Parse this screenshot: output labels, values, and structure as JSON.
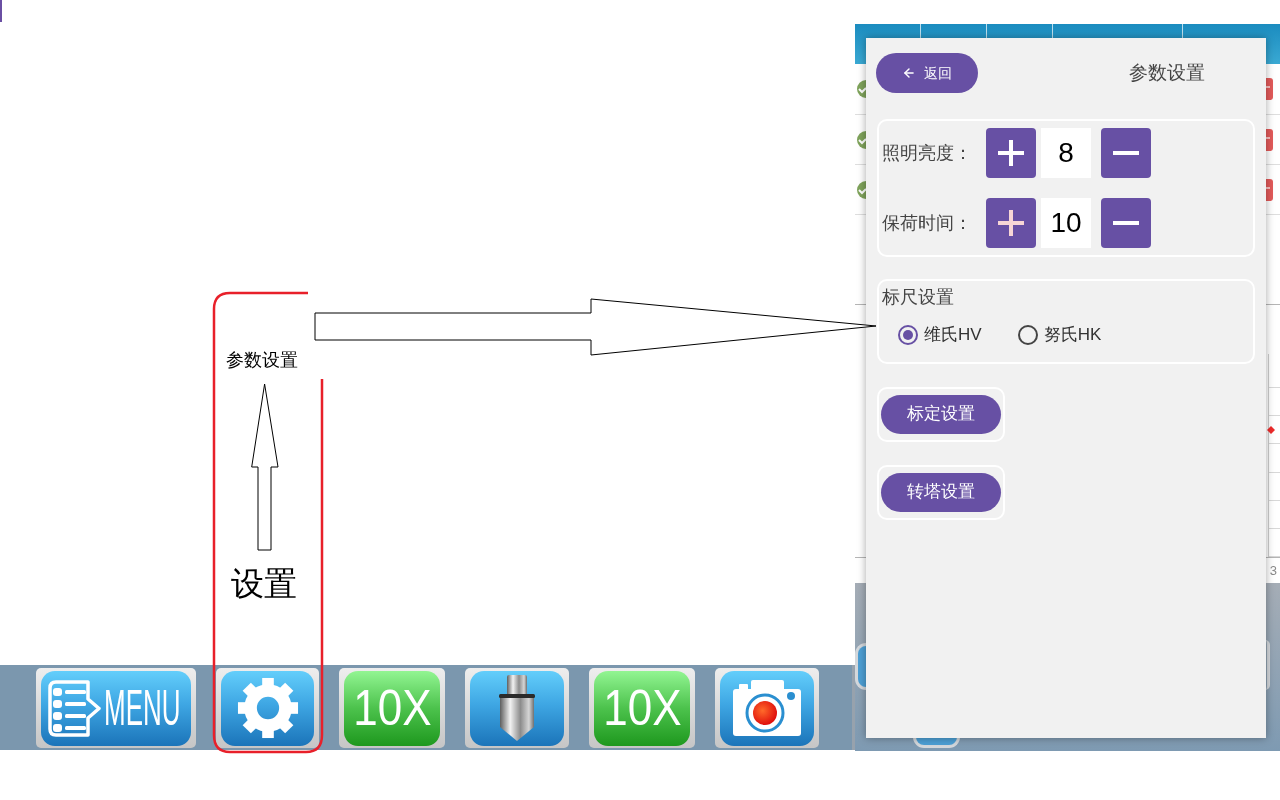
{
  "annotations": {
    "label": "参数设置",
    "caption": "设置"
  },
  "toolbar": {
    "buttons": [
      {
        "kind": "menu",
        "label": "MENU"
      },
      {
        "kind": "settings"
      },
      {
        "kind": "zoom",
        "label": "10X"
      },
      {
        "kind": "probe"
      },
      {
        "kind": "zoom",
        "label": "10X"
      },
      {
        "kind": "camera"
      }
    ]
  },
  "background_app": {
    "edge_text": "3"
  },
  "dialog": {
    "back_button": "返回",
    "title": "参数设置",
    "adjusters": [
      {
        "label": "照明亮度：",
        "value": "8",
        "plus_pressed": false
      },
      {
        "label": "保荷时间：",
        "value": "10",
        "plus_pressed": true
      }
    ],
    "scale_group": {
      "title": "标尺设置",
      "options": [
        {
          "label": "维氏HV",
          "selected": true
        },
        {
          "label": "努氏HK",
          "selected": false
        }
      ]
    },
    "action_buttons": [
      "标定设置",
      "转塔设置"
    ]
  }
}
